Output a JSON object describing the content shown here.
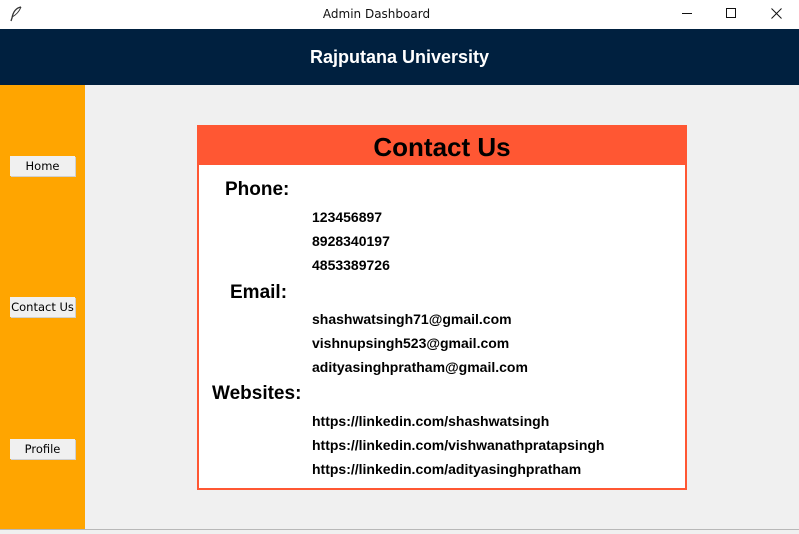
{
  "window": {
    "title": "Admin Dashboard",
    "icon": "feather-icon",
    "controls": [
      "minimize-icon",
      "maximize-icon",
      "close-icon"
    ]
  },
  "header": {
    "title": "Rajputana University"
  },
  "sidebar": {
    "items": [
      {
        "label": "Home"
      },
      {
        "label": "Contact Us"
      },
      {
        "label": "Profile"
      }
    ]
  },
  "contact": {
    "title": "Contact Us",
    "phone": {
      "label": "Phone:",
      "values": [
        "123456897",
        "8928340197",
        "4853389726"
      ]
    },
    "email": {
      "label": "Email:",
      "values": [
        "shashwatsingh71@gmail.com",
        "vishnupsingh523@gmail.com",
        "adityasinghpratham@gmail.com"
      ]
    },
    "websites": {
      "label": "Websites:",
      "values": [
        "https://linkedin.com/shashwatsingh",
        "https://linkedin.com/vishwanathpratapsingh",
        "https://linkedin.com/adityasinghpratham"
      ]
    }
  },
  "colors": {
    "header_bg": "#00203f",
    "sidebar_bg": "#ffa500",
    "accent": "#ff5733",
    "content_bg": "#f0f0f0"
  }
}
